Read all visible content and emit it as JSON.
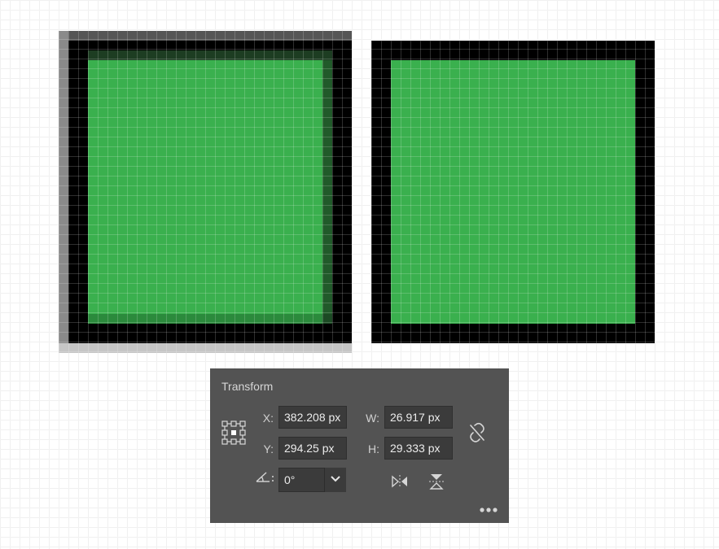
{
  "panel": {
    "title": "Transform",
    "x": {
      "label": "X:",
      "value": "382.208 px"
    },
    "y": {
      "label": "Y:",
      "value": "294.25 px"
    },
    "w": {
      "label": "W:",
      "value": "26.917 px"
    },
    "h": {
      "label": "H:",
      "value": "29.333 px"
    },
    "angle": {
      "value": "0°",
      "icon": "rotate-angle-icon",
      "dropdown_icon": "chevron-down-icon"
    },
    "reference_point_icon": "reference-point-icon",
    "constrain_icon": "broken-link-icon",
    "flip_horizontal_icon": "flip-horizontal-icon",
    "flip_vertical_icon": "flip-vertical-icon",
    "more_icon": "more-options-icon"
  },
  "colors": {
    "panel_bg": "#535353",
    "field_bg": "#3b3b3b",
    "shape_green": "#3ab04e",
    "frame_black": "#000000"
  }
}
